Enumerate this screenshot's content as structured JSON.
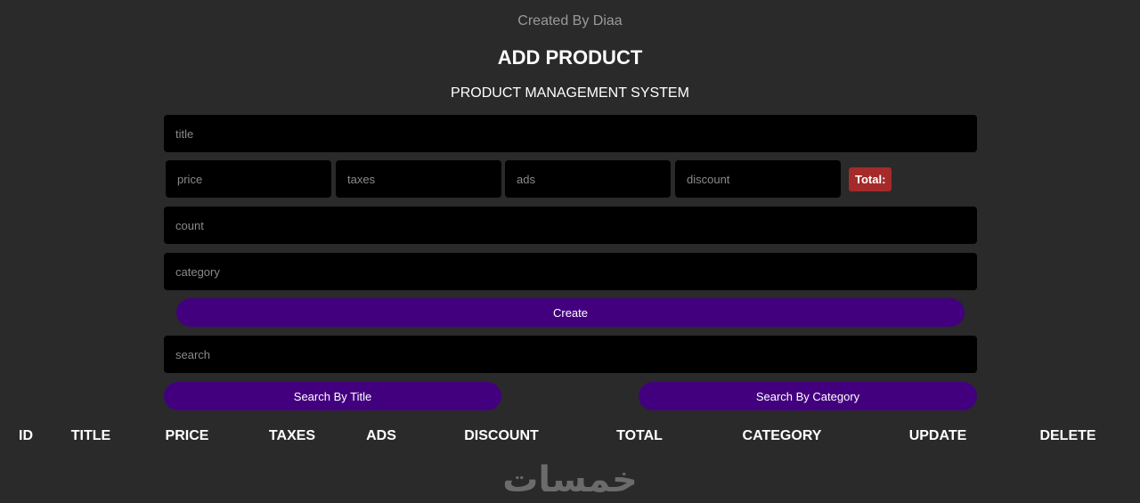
{
  "header": {
    "credit": "Created By Diaa",
    "title": "ADD PRODUCT",
    "subtitle": "PRODUCT MANAGEMENT SYSTEM"
  },
  "form": {
    "title_placeholder": "title",
    "price_placeholder": "price",
    "taxes_placeholder": "taxes",
    "ads_placeholder": "ads",
    "discount_placeholder": "discount",
    "total_label": "Total:",
    "total_color": "#a52a2a",
    "count_placeholder": "count",
    "category_placeholder": "category",
    "create_label": "Create"
  },
  "search": {
    "placeholder": "search",
    "by_title_label": "Search By Title",
    "by_category_label": "Search By Category"
  },
  "table": {
    "headers": [
      "ID",
      "TITLE",
      "PRICE",
      "TAXES",
      "ADS",
      "DISCOUNT",
      "TOTAL",
      "CATEGORY",
      "UPDATE",
      "DELETE"
    ]
  },
  "theme": {
    "background": "#2a2a2a",
    "input_bg": "#000000",
    "button_color": "#42007f"
  },
  "watermark": {
    "logo_text": "خمسات"
  }
}
